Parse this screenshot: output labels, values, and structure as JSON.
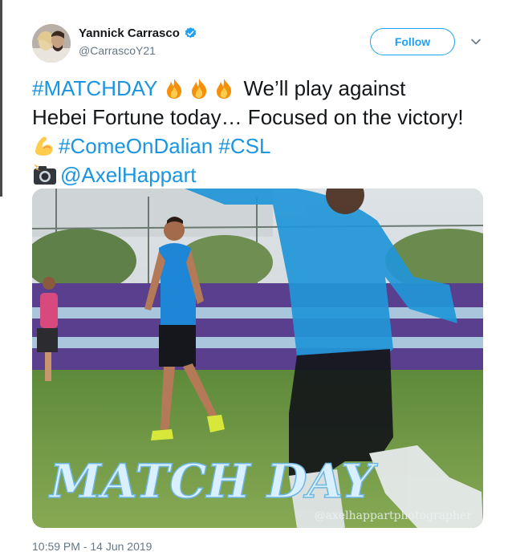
{
  "user": {
    "name": "Yannick Carrasco",
    "handle": "@CarrascoY21",
    "verified": true
  },
  "follow_button": {
    "label": "Follow"
  },
  "tweet": {
    "line1_tag": "#MATCHDAY",
    "line1_text": " We’ll play against",
    "line2_text": "Hebei Fortune today… Focused on the victory!",
    "line3_tags": "#ComeOnDalian #CSL",
    "line4_mention": "@AxelHappart",
    "emojis": [
      "fire-emoji",
      "fire-emoji",
      "fire-emoji",
      "flexed-biceps-emoji",
      "camera-with-flash-emoji"
    ]
  },
  "media": {
    "overlay_title": "MATCH DAY",
    "watermark": "@axelhappartphotographer"
  },
  "timestamp": "10:59 PM - 14 Jun 2019",
  "colors": {
    "link": "#1b95e0",
    "follow": "#1da1f2",
    "muted": "#657786",
    "text": "#14171a"
  }
}
